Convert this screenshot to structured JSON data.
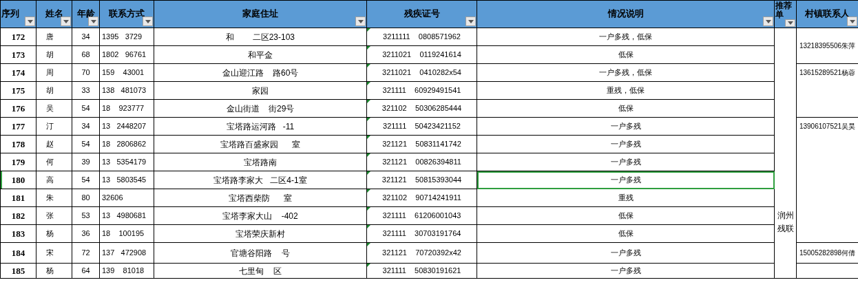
{
  "columns": [
    {
      "label": "序列",
      "filter": true
    },
    {
      "label": "姓名",
      "filter": true
    },
    {
      "label": "年龄",
      "filter": true
    },
    {
      "label": "联系方式",
      "filter": true
    },
    {
      "label": "家庭住址",
      "filter": true
    },
    {
      "label": "残疾证号",
      "filter": true
    },
    {
      "label": "情况说明",
      "filter": true
    },
    {
      "label": "推荐单",
      "filter": true
    },
    {
      "label": "村镇联系人",
      "filter": true
    }
  ],
  "sections": [
    {
      "recommender": "润州残联",
      "contact_groups": [
        {
          "contact": "13218395506朱萍",
          "rows": [
            {
              "seq": "172",
              "name": "唐",
              "age": "34",
              "phone": "1395   3729",
              "address": "和        二区23-103",
              "id": "3211111    0808571962",
              "note": "一户多残，低保",
              "selected": false
            },
            {
              "seq": "173",
              "name": "胡",
              "age": "68",
              "phone": "1802   96761",
              "address": "和平金",
              "id": "3211021    0119241614",
              "note": "低保",
              "selected": false
            }
          ]
        },
        {
          "contact": "13615289521杨蓉",
          "rows": [
            {
              "seq": "174",
              "name": "周",
              "age": "70",
              "phone": "159    43001",
              "address": "金山迎江路    路60号",
              "id": "3211021    0410282x54",
              "note": "一户多残，低保",
              "selected": false
            },
            {
              "seq": "175",
              "name": "胡",
              "age": "33",
              "phone": "138   481073",
              "address": "家园",
              "id": "321111    60929491541",
              "note": "重残，低保",
              "selected": false
            },
            {
              "seq": "176",
              "name": "吴",
              "age": "54",
              "phone": "18    923777",
              "address": "金山街道    街29号",
              "id": "321102    50306285444",
              "note": "低保",
              "selected": false
            }
          ]
        },
        {
          "contact": "13906107521吴昊",
          "rows": [
            {
              "seq": "177",
              "name": "汀",
              "age": "34",
              "phone": "13   2448207",
              "address": "宝塔路运河路   -11",
              "id": "321111    50423421152",
              "note": "一户多残",
              "selected": false
            },
            {
              "seq": "178",
              "name": "赵",
              "age": "54",
              "phone": "18   2806862",
              "address": "宝塔路百盛家园      室",
              "id": "321121    50831141742",
              "note": "一户多残",
              "selected": false
            },
            {
              "seq": "179",
              "name": "何",
              "age": "39",
              "phone": "13   5354179",
              "address": "宝塔路南",
              "id": "321121    00826394811",
              "note": "一户多残",
              "selected": false
            },
            {
              "seq": "180",
              "name": "高",
              "age": "54",
              "phone": "13   5803545",
              "address": "宝塔路李家大   二区4-1室",
              "id": "321121    50815393044",
              "note": "一户多残",
              "selected": true
            },
            {
              "seq": "181",
              "name": "朱",
              "age": "80",
              "phone": "32606",
              "address": "宝塔西柴防      室",
              "id": "321102    90714241911",
              "note": "重残",
              "selected": false
            },
            {
              "seq": "182",
              "name": "张",
              "age": "53",
              "phone": "13   4980681",
              "address": "宝塔李家大山    -402",
              "id": "321111    61206001043",
              "note": "低保",
              "selected": false
            },
            {
              "seq": "183",
              "name": "杨",
              "age": "36",
              "phone": "18    100195",
              "address": "宝塔荣庆新村",
              "id": "321111    30703191764",
              "note": "低保",
              "selected": false
            }
          ]
        },
        {
          "contact": "15005282898何倩",
          "rows": [
            {
              "seq": "184",
              "name": "宋",
              "age": "72",
              "phone": "137   472908",
              "address": "官塘谷阳路    号",
              "id": "321121    70720392x42",
              "note": "一户多残",
              "selected": false
            }
          ]
        },
        {
          "rows": [
            {
              "seq": "185",
              "name": "杨",
              "age": "64",
              "phone": "139    81018",
              "address": "七里甸    区",
              "id": "321111    50830191621",
              "note": "一户多残",
              "selected": false
            }
          ]
        }
      ]
    }
  ]
}
